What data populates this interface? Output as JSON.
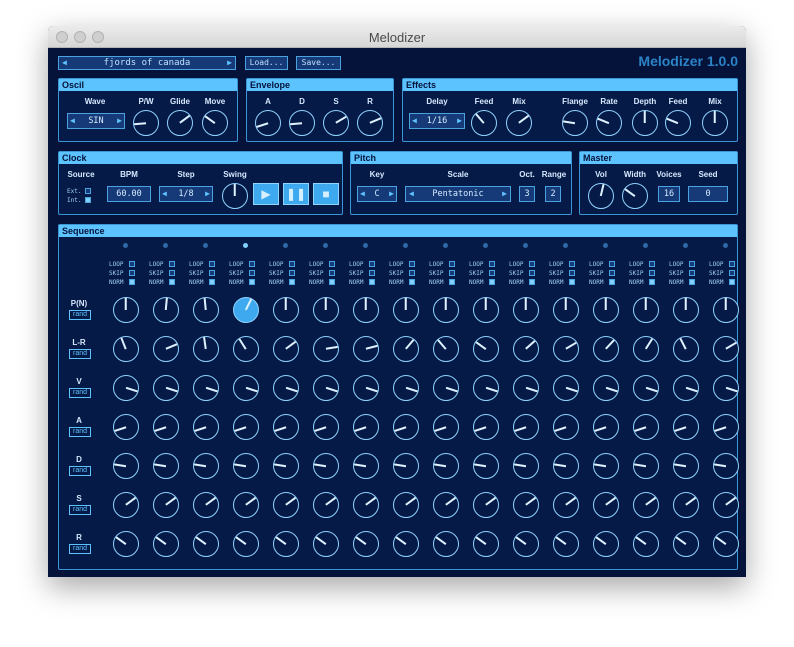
{
  "window": {
    "title": "Melodizer"
  },
  "header": {
    "preset_name": "fjords of canada",
    "load_label": "Load...",
    "save_label": "Save...",
    "brand": "Melodizer 1.0.0"
  },
  "oscil": {
    "title": "Oscil",
    "wave_label": "Wave",
    "wave_value": "SIN",
    "pw_label": "P/W",
    "glide_label": "Glide",
    "move_label": "Move"
  },
  "envelope": {
    "title": "Envelope",
    "a": "A",
    "d": "D",
    "s": "S",
    "r": "R"
  },
  "effects": {
    "title": "Effects",
    "delay_label": "Delay",
    "delay_value": "1/16",
    "feed_label": "Feed",
    "mix_label": "Mix",
    "flange_label": "Flange",
    "rate_label": "Rate",
    "depth_label": "Depth",
    "feed2_label": "Feed",
    "mix2_label": "Mix"
  },
  "clock": {
    "title": "Clock",
    "source_label": "Source",
    "ext_label": "Ext.",
    "int_label": "Int.",
    "bpm_label": "BPM",
    "bpm_value": "60.00",
    "step_label": "Step",
    "step_value": "1/8",
    "swing_label": "Swing"
  },
  "pitch": {
    "title": "Pitch",
    "key_label": "Key",
    "key_value": "C",
    "scale_label": "Scale",
    "scale_value": "Pentatonic",
    "oct_label": "Oct.",
    "oct_value": "3",
    "range_label": "Range",
    "range_value": "2"
  },
  "master": {
    "title": "Master",
    "vol_label": "Vol",
    "width_label": "Width",
    "voices_label": "Voices",
    "voices_value": "16",
    "seed_label": "Seed",
    "seed_value": "0"
  },
  "sequence": {
    "title": "Sequence",
    "step_count": 16,
    "loop_label": "LOOP",
    "skip_label": "SKIP",
    "norm_label": "NORM",
    "rand_label": "rand",
    "active_step": 4,
    "rows": [
      {
        "label": "P(N)",
        "values": [
          0.5,
          0.52,
          0.48,
          0.6,
          0.5,
          0.5,
          0.5,
          0.5,
          0.5,
          0.5,
          0.5,
          0.5,
          0.5,
          0.5,
          0.5,
          0.5
        ]
      },
      {
        "label": "L-R",
        "values": [
          0.42,
          0.75,
          0.47,
          0.38,
          0.7,
          0.8,
          0.78,
          0.65,
          0.35,
          0.3,
          0.68,
          0.72,
          0.66,
          0.62,
          0.4,
          0.72
        ]
      },
      {
        "label": "V",
        "values": [
          0.9,
          0.9,
          0.9,
          0.9,
          0.9,
          0.9,
          0.9,
          0.9,
          0.9,
          0.9,
          0.9,
          0.9,
          0.9,
          0.9,
          0.9,
          0.9
        ]
      },
      {
        "label": "A",
        "values": [
          0.1,
          0.1,
          0.1,
          0.1,
          0.1,
          0.1,
          0.1,
          0.1,
          0.1,
          0.1,
          0.1,
          0.1,
          0.1,
          0.1,
          0.1,
          0.1
        ]
      },
      {
        "label": "D",
        "values": [
          0.2,
          0.2,
          0.2,
          0.2,
          0.2,
          0.2,
          0.2,
          0.2,
          0.2,
          0.2,
          0.2,
          0.2,
          0.2,
          0.2,
          0.2,
          0.2
        ]
      },
      {
        "label": "S",
        "values": [
          0.7,
          0.7,
          0.7,
          0.7,
          0.7,
          0.7,
          0.7,
          0.7,
          0.7,
          0.7,
          0.7,
          0.7,
          0.7,
          0.7,
          0.7,
          0.7
        ]
      },
      {
        "label": "R",
        "values": [
          0.3,
          0.3,
          0.3,
          0.3,
          0.3,
          0.3,
          0.3,
          0.3,
          0.3,
          0.3,
          0.3,
          0.3,
          0.3,
          0.3,
          0.3,
          0.3
        ]
      }
    ]
  },
  "colors": {
    "background": "#05123a",
    "panel_header": "#5cc3ff",
    "accent": "#3ea9ee",
    "knob_ring": "#8fd3ff"
  }
}
